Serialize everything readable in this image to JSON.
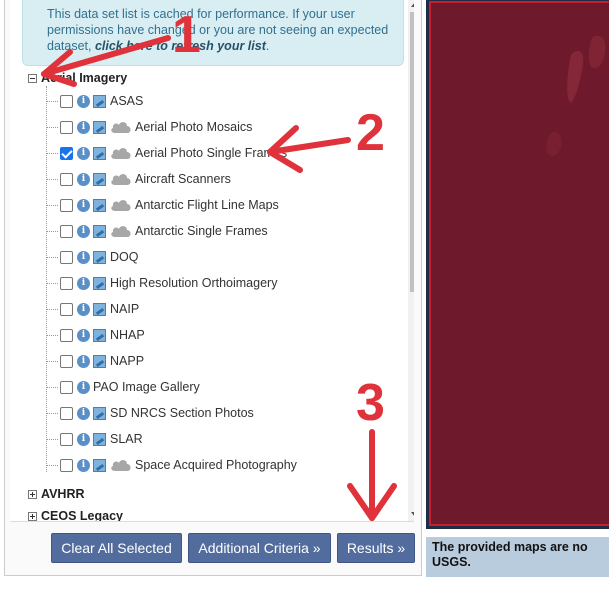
{
  "notice": {
    "text": "This data set list is cached for performance. If your user permissions have changed or you are not seeing an expected dataset, ",
    "link": "click here to refresh your list",
    "suffix": "."
  },
  "categories": [
    {
      "label": "Aerial Imagery",
      "expanded": true
    },
    {
      "label": "AVHRR",
      "expanded": false
    },
    {
      "label": "CEOS Legacy",
      "expanded": false
    }
  ],
  "datasets": [
    {
      "label": "ASAS",
      "checked": false,
      "icons": [
        "info-icon",
        "map-icon"
      ]
    },
    {
      "label": "Aerial Photo Mosaics",
      "checked": false,
      "icons": [
        "info-icon",
        "map-icon",
        "cloud-icon"
      ]
    },
    {
      "label": "Aerial Photo Single Frames",
      "checked": true,
      "icons": [
        "info-icon",
        "map-icon",
        "cloud-icon"
      ]
    },
    {
      "label": "Aircraft Scanners",
      "checked": false,
      "icons": [
        "info-icon",
        "map-icon",
        "cloud-icon"
      ]
    },
    {
      "label": "Antarctic Flight Line Maps",
      "checked": false,
      "icons": [
        "info-icon",
        "map-icon",
        "cloud-icon"
      ]
    },
    {
      "label": "Antarctic Single Frames",
      "checked": false,
      "icons": [
        "info-icon",
        "map-icon",
        "cloud-icon"
      ]
    },
    {
      "label": "DOQ",
      "checked": false,
      "icons": [
        "info-icon",
        "map-icon"
      ]
    },
    {
      "label": "High Resolution Orthoimagery",
      "checked": false,
      "icons": [
        "info-icon",
        "map-icon"
      ]
    },
    {
      "label": "NAIP",
      "checked": false,
      "icons": [
        "info-icon",
        "map-icon"
      ]
    },
    {
      "label": "NHAP",
      "checked": false,
      "icons": [
        "info-icon",
        "map-icon"
      ]
    },
    {
      "label": "NAPP",
      "checked": false,
      "icons": [
        "info-icon",
        "map-icon"
      ]
    },
    {
      "label": "PAO Image Gallery",
      "checked": false,
      "icons": [
        "info-icon"
      ]
    },
    {
      "label": "SD NRCS Section Photos",
      "checked": false,
      "icons": [
        "info-icon",
        "map-icon"
      ]
    },
    {
      "label": "SLAR",
      "checked": false,
      "icons": [
        "info-icon",
        "map-icon"
      ]
    },
    {
      "label": "Space Acquired Photography",
      "checked": false,
      "icons": [
        "info-icon",
        "map-icon",
        "cloud-icon"
      ]
    }
  ],
  "buttons": {
    "clear": "Clear All Selected",
    "criteria": "Additional Criteria »",
    "results": "Results »"
  },
  "map": {
    "caption": "The provided maps are no\nUSGS."
  },
  "annotations": [
    "1",
    "2",
    "3"
  ],
  "colors": {
    "button": "#536c9e",
    "annotation": "#e0323a",
    "notice_bg": "#d9eef3",
    "map_bg": "#6e1a2c"
  }
}
